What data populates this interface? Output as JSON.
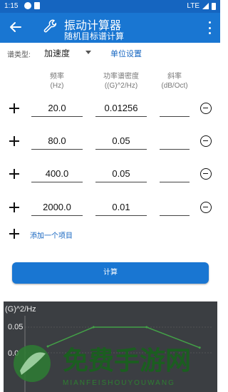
{
  "status": {
    "time": "1:15",
    "network": "LTE"
  },
  "appbar": {
    "title": "振动计算器",
    "subtitle": "随机目标谱计算"
  },
  "spectrum": {
    "label": "谱类型:",
    "selected": "加速度",
    "unit_settings": "单位设置"
  },
  "columns": {
    "freq": [
      "频率",
      "(Hz)"
    ],
    "psd": [
      "功率谱密度",
      "((G)^2/Hz)"
    ],
    "slope": [
      "斜率",
      "(dB/Oct)"
    ]
  },
  "rows": [
    {
      "freq": "20.0",
      "psd": "0.01256",
      "slope": ""
    },
    {
      "freq": "80.0",
      "psd": "0.05",
      "slope": ""
    },
    {
      "freq": "400.0",
      "psd": "0.05",
      "slope": ""
    },
    {
      "freq": "2000.0",
      "psd": "0.01",
      "slope": ""
    }
  ],
  "add_item": "添加一个项目",
  "calculate": "计算",
  "chart_data": {
    "type": "line",
    "ylabel": "(G)^2/Hz",
    "yticks": [
      "0.05",
      "0.0"
    ],
    "series": [
      {
        "x": [
          20,
          80,
          400,
          2000
        ],
        "values": [
          0.01256,
          0.05,
          0.05,
          0.01
        ]
      }
    ]
  },
  "watermark": {
    "title": "免费手游网",
    "subtitle": "MIANFEISHOUYOUWANG"
  }
}
